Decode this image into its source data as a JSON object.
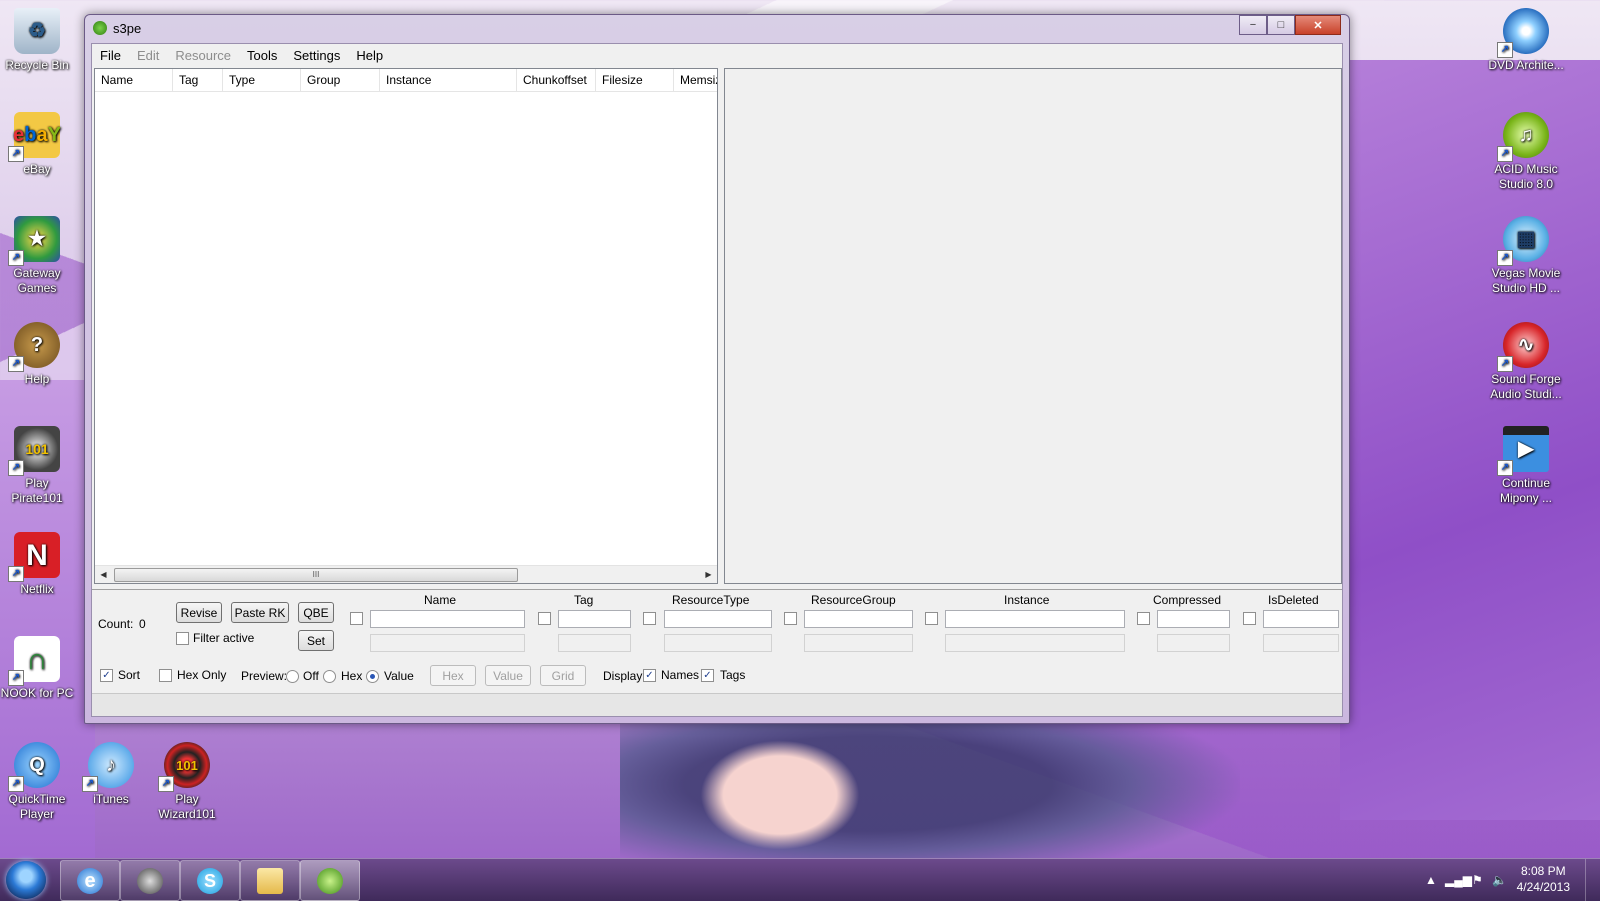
{
  "desktop": {
    "left_icons": [
      {
        "label": "Recycle Bin",
        "icon": "recycle-bin-icon"
      },
      {
        "label": "eBay",
        "icon": "ebay-icon"
      },
      {
        "label": "Gateway Games",
        "icon": "gateway-games-icon"
      },
      {
        "label": "Help",
        "icon": "help-icon"
      },
      {
        "label": "Play Pirate101",
        "icon": "pirate101-icon"
      },
      {
        "label": "Netflix",
        "icon": "netflix-icon"
      },
      {
        "label": "NOOK for PC",
        "icon": "nook-icon"
      },
      {
        "label": "QuickTime Player",
        "icon": "quicktime-icon"
      },
      {
        "label": "iTunes",
        "icon": "itunes-icon"
      },
      {
        "label": "Play Wizard101",
        "icon": "wizard101-icon"
      }
    ],
    "right_icons": [
      {
        "label": "DVD Archite...",
        "icon": "dvd-architect-icon"
      },
      {
        "label": "ACID Music Studio 8.0",
        "icon": "acid-music-icon"
      },
      {
        "label": "Vegas Movie Studio HD ...",
        "icon": "vegas-movie-icon"
      },
      {
        "label": "Sound Forge Audio Studi...",
        "icon": "sound-forge-icon"
      },
      {
        "label": "Continue Mipony ...",
        "icon": "mipony-icon"
      }
    ]
  },
  "window": {
    "title": "s3pe",
    "controls": {
      "minimize": "−",
      "maximize": "□",
      "close": "✕"
    },
    "menu": [
      {
        "label": "File",
        "enabled": true
      },
      {
        "label": "Edit",
        "enabled": false
      },
      {
        "label": "Resource",
        "enabled": false
      },
      {
        "label": "Tools",
        "enabled": true
      },
      {
        "label": "Settings",
        "enabled": true
      },
      {
        "label": "Help",
        "enabled": true
      }
    ],
    "list": {
      "columns": [
        "Name",
        "Tag",
        "Type",
        "Group",
        "Instance",
        "Chunkoffset",
        "Filesize",
        "Memsize"
      ],
      "scroll_thumb": "III"
    },
    "bottom": {
      "count_label": "Count:",
      "count_value": "0",
      "revise": "Revise",
      "paste_rk": "Paste RK",
      "qbe": "QBE",
      "set": "Set",
      "filter_active": "Filter active",
      "filter_fields": [
        "Name",
        "Tag",
        "ResourceType",
        "ResourceGroup",
        "Instance",
        "Compressed",
        "IsDeleted"
      ],
      "sort": "Sort",
      "hex_only": "Hex Only",
      "preview_label": "Preview:",
      "preview_options": [
        "Off",
        "Hex",
        "Value"
      ],
      "preview_selected": "Value",
      "hex_btn": "Hex",
      "value_btn": "Value",
      "grid_btn": "Grid",
      "display_label": "Display:",
      "names": "Names",
      "tags": "Tags"
    }
  },
  "taskbar": {
    "apps": [
      "internet-explorer-icon",
      "steam-icon",
      "skype-icon",
      "explorer-icon",
      "s3pe-icon"
    ],
    "time": "8:08 PM",
    "date": "4/24/2013"
  }
}
